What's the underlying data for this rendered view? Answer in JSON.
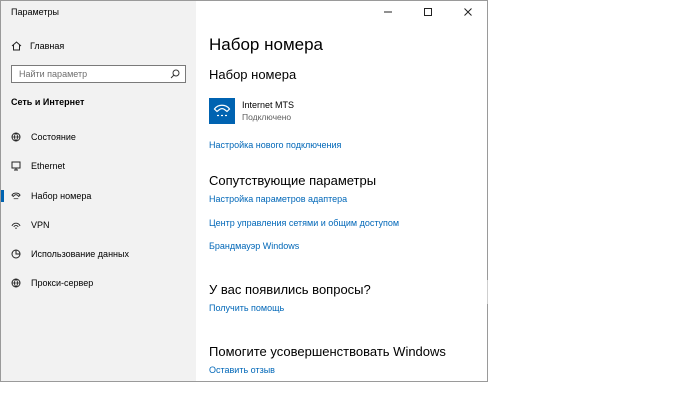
{
  "window": {
    "title": "Параметры"
  },
  "sidebar": {
    "home_label": "Главная",
    "search_placeholder": "Найти параметр",
    "section_title": "Сеть и Интернет",
    "items": [
      {
        "label": "Состояние",
        "icon": "globe-status-icon"
      },
      {
        "label": "Ethernet",
        "icon": "ethernet-icon"
      },
      {
        "label": "Набор номера",
        "icon": "dialup-phone-icon",
        "active": true
      },
      {
        "label": "VPN",
        "icon": "vpn-icon"
      },
      {
        "label": "Использование данных",
        "icon": "data-usage-icon"
      },
      {
        "label": "Прокси-сервер",
        "icon": "proxy-globe-icon"
      }
    ]
  },
  "main": {
    "page_title": "Набор номера",
    "section_title": "Набор номера",
    "connection": {
      "name": "Internet MTS",
      "status": "Подключено"
    },
    "new_connection_link": "Настройка нового подключения",
    "related_title": "Сопутствующие параметры",
    "related_links": [
      "Настройка параметров адаптера",
      "Центр управления сетями и общим доступом",
      "Брандмауэр Windows"
    ],
    "questions_title": "У вас появились вопросы?",
    "help_link": "Получить помощь",
    "improve_title": "Помогите усовершенствовать Windows",
    "feedback_link": "Оставить отзыв"
  },
  "colors": {
    "accent": "#0063b1",
    "link": "#0067b8",
    "sidebar_bg": "#f2f2f2"
  }
}
